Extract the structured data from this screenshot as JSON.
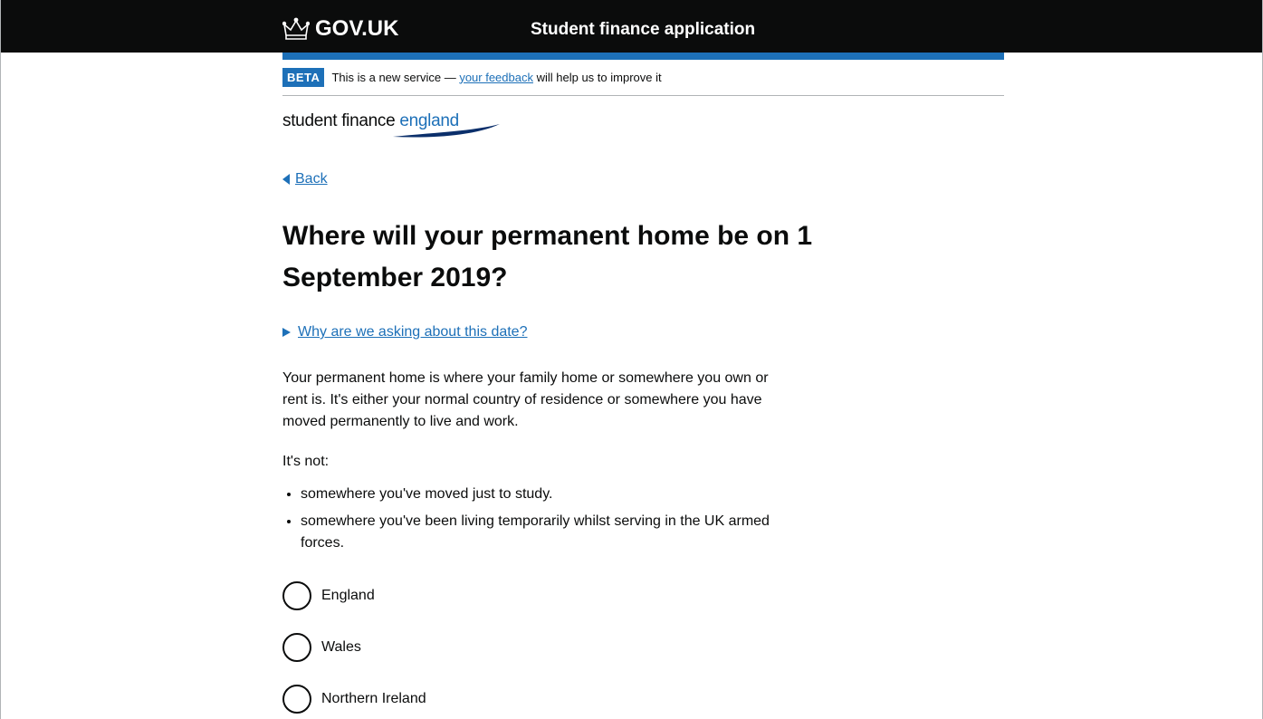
{
  "header": {
    "logo_text": "GOV.UK",
    "service_name": "Student finance application"
  },
  "phase_banner": {
    "tag": "BETA",
    "text_before": "This is a new service — ",
    "link": "your feedback",
    "text_after": " will help us to improve it"
  },
  "brand": {
    "part1": "student finance ",
    "part2": "england"
  },
  "back_link": "Back",
  "heading": "Where will your permanent home be on 1 September 2019?",
  "details_summary": "Why are we asking about this date?",
  "body": {
    "paragraph": "Your permanent home is where your family home or somewhere you own or rent is. It's either your normal country of residence or somewhere you have moved permanently to live and work.",
    "its_not": "It's not:",
    "bullets": [
      "somewhere you've moved just to study.",
      "somewhere you've been living temporarily whilst serving in the UK armed forces."
    ]
  },
  "radios": [
    {
      "label": "England"
    },
    {
      "label": "Wales"
    },
    {
      "label": "Northern Ireland"
    }
  ],
  "colors": {
    "header_bg": "#0b0c0c",
    "link_blue": "#1d70b8",
    "text": "#0b0c0c"
  }
}
